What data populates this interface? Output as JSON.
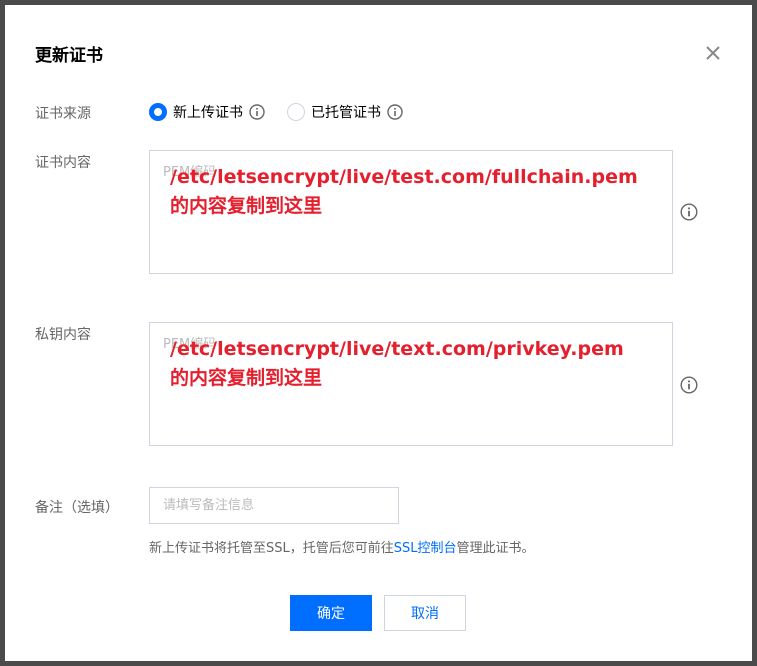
{
  "dialog": {
    "title": "更新证书"
  },
  "cert_source": {
    "label": "证书来源",
    "options": [
      {
        "label": "新上传证书",
        "checked": true
      },
      {
        "label": "已托管证书",
        "checked": false
      }
    ]
  },
  "cert_content": {
    "label": "证书内容",
    "placeholder": "PEM编码",
    "overlay_line1": "/etc/letsencrypt/live/test.com/fullchain.pem",
    "overlay_line2": "的内容复制到这里"
  },
  "private_key": {
    "label": "私钥内容",
    "placeholder": "PEM编码",
    "overlay_line1": "/etc/letsencrypt/live/text.com/privkey.pem",
    "overlay_line2": "的内容复制到这里"
  },
  "remark": {
    "label": "备注（选填）",
    "placeholder": "请填写备注信息"
  },
  "hint": {
    "before": "新上传证书将托管至SSL，托管后您可前往",
    "link": "SSL控制台",
    "after": "管理此证书。"
  },
  "buttons": {
    "confirm": "确定",
    "cancel": "取消"
  },
  "colors": {
    "primary": "#006eff",
    "annotation": "#e5202e"
  }
}
